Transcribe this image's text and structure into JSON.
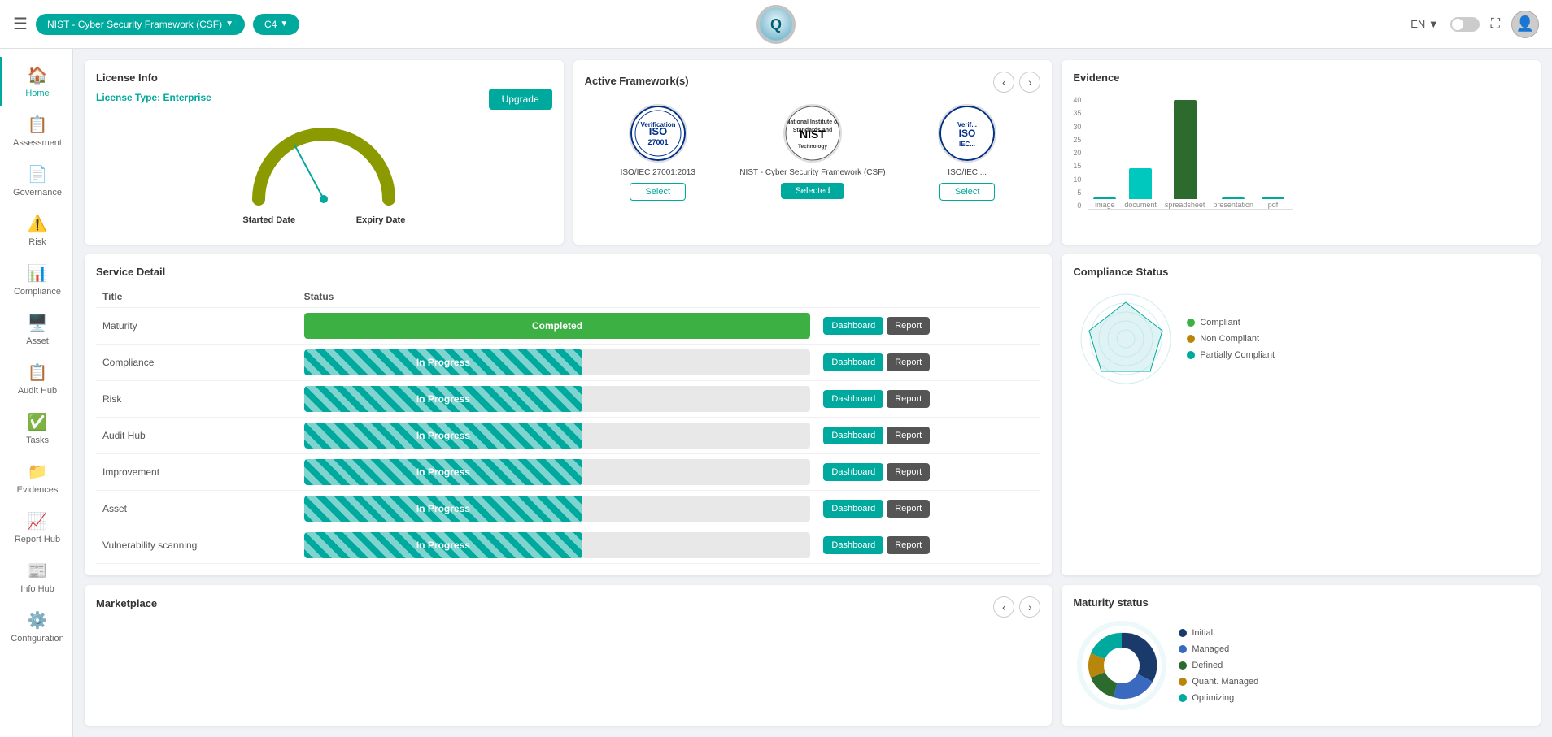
{
  "header": {
    "hamburger": "☰",
    "framework_btn": "NIST - Cyber Security Framework (CSF)",
    "c4_btn": "C4",
    "logo_letter": "Q",
    "lang": "EN",
    "fullscreen": "⛶"
  },
  "sidebar": {
    "items": [
      {
        "id": "home",
        "label": "Home",
        "icon": "🏠",
        "active": true
      },
      {
        "id": "assessment",
        "label": "Assessment",
        "icon": "📋",
        "active": false
      },
      {
        "id": "governance",
        "label": "Governance",
        "icon": "📄",
        "active": false
      },
      {
        "id": "risk",
        "label": "Risk",
        "icon": "⚠️",
        "active": false
      },
      {
        "id": "compliance",
        "label": "Compliance",
        "icon": "📊",
        "active": false
      },
      {
        "id": "asset",
        "label": "Asset",
        "icon": "🖥️",
        "active": false
      },
      {
        "id": "audit-hub",
        "label": "Audit Hub",
        "icon": "📋",
        "active": false
      },
      {
        "id": "tasks",
        "label": "Tasks",
        "icon": "✅",
        "active": false
      },
      {
        "id": "evidences",
        "label": "Evidences",
        "icon": "📁",
        "active": false
      },
      {
        "id": "report-hub",
        "label": "Report Hub",
        "icon": "📈",
        "active": false
      },
      {
        "id": "info-hub",
        "label": "Info Hub",
        "icon": "📰",
        "active": false
      },
      {
        "id": "configuration",
        "label": "Configuration",
        "icon": "⚙️",
        "active": false
      }
    ]
  },
  "license": {
    "title": "License Info",
    "type_label": "License Type:",
    "type_value": "Enterprise",
    "upgrade_btn": "Upgrade",
    "started_label": "Started Date",
    "expiry_label": "Expiry Date"
  },
  "frameworks": {
    "title": "Active Framework(s)",
    "items": [
      {
        "name": "ISO/IEC 27001:2013",
        "label": "ISO 27001",
        "btn_label": "Select",
        "selected": false
      },
      {
        "name": "NIST - Cyber Security Framework (CSF)",
        "label": "NIST",
        "btn_label": "Selected",
        "selected": true
      },
      {
        "name": "ISO/IEC ...",
        "label": "ISO/IEC...",
        "btn_label": "Select",
        "selected": false
      }
    ]
  },
  "evidence": {
    "title": "Evidence",
    "y_labels": [
      "40",
      "35",
      "30",
      "25",
      "20",
      "15",
      "10",
      "5",
      "0"
    ],
    "bars": [
      {
        "label": "image",
        "value": 0,
        "height": 0,
        "color": "#00a99d"
      },
      {
        "label": "document",
        "value": 10,
        "height": 40,
        "color": "#00c8be"
      },
      {
        "label": "spreadsheet",
        "value": 37,
        "height": 120,
        "color": "#2d6a2d"
      },
      {
        "label": "presentation",
        "value": 0,
        "height": 0,
        "color": "#00a99d"
      },
      {
        "label": "pdf",
        "value": 0,
        "height": 0,
        "color": "#00a99d"
      }
    ]
  },
  "service": {
    "title": "Service Detail",
    "col_title": "Title",
    "col_status": "Status",
    "rows": [
      {
        "title": "Maturity",
        "status": "Completed",
        "type": "completed"
      },
      {
        "title": "Compliance",
        "status": "In Progress",
        "type": "inprogress"
      },
      {
        "title": "Risk",
        "status": "In Progress",
        "type": "inprogress"
      },
      {
        "title": "Audit Hub",
        "status": "In Progress",
        "type": "inprogress"
      },
      {
        "title": "Improvement",
        "status": "In Progress",
        "type": "inprogress"
      },
      {
        "title": "Asset",
        "status": "In Progress",
        "type": "inprogress"
      },
      {
        "title": "Vulnerability scanning",
        "status": "In Progress",
        "type": "inprogress"
      }
    ],
    "dashboard_btn": "Dashboard",
    "report_btn": "Report"
  },
  "compliance_status": {
    "title": "Compliance Status",
    "legend": [
      {
        "label": "Compliant",
        "color": "#3cb043"
      },
      {
        "label": "Non Compliant",
        "color": "#b8860b"
      },
      {
        "label": "Partially Compliant",
        "color": "#00a99d"
      }
    ]
  },
  "maturity_status": {
    "title": "Maturity status",
    "legend": [
      {
        "label": "Initial",
        "color": "#1a3a6b"
      },
      {
        "label": "Managed",
        "color": "#3a6abf"
      },
      {
        "label": "Defined",
        "color": "#2d6a2d"
      },
      {
        "label": "Quant. Managed",
        "color": "#b8860b"
      },
      {
        "label": "Optimizing",
        "color": "#00a99d"
      }
    ]
  },
  "marketplace": {
    "title": "Marketplace"
  }
}
